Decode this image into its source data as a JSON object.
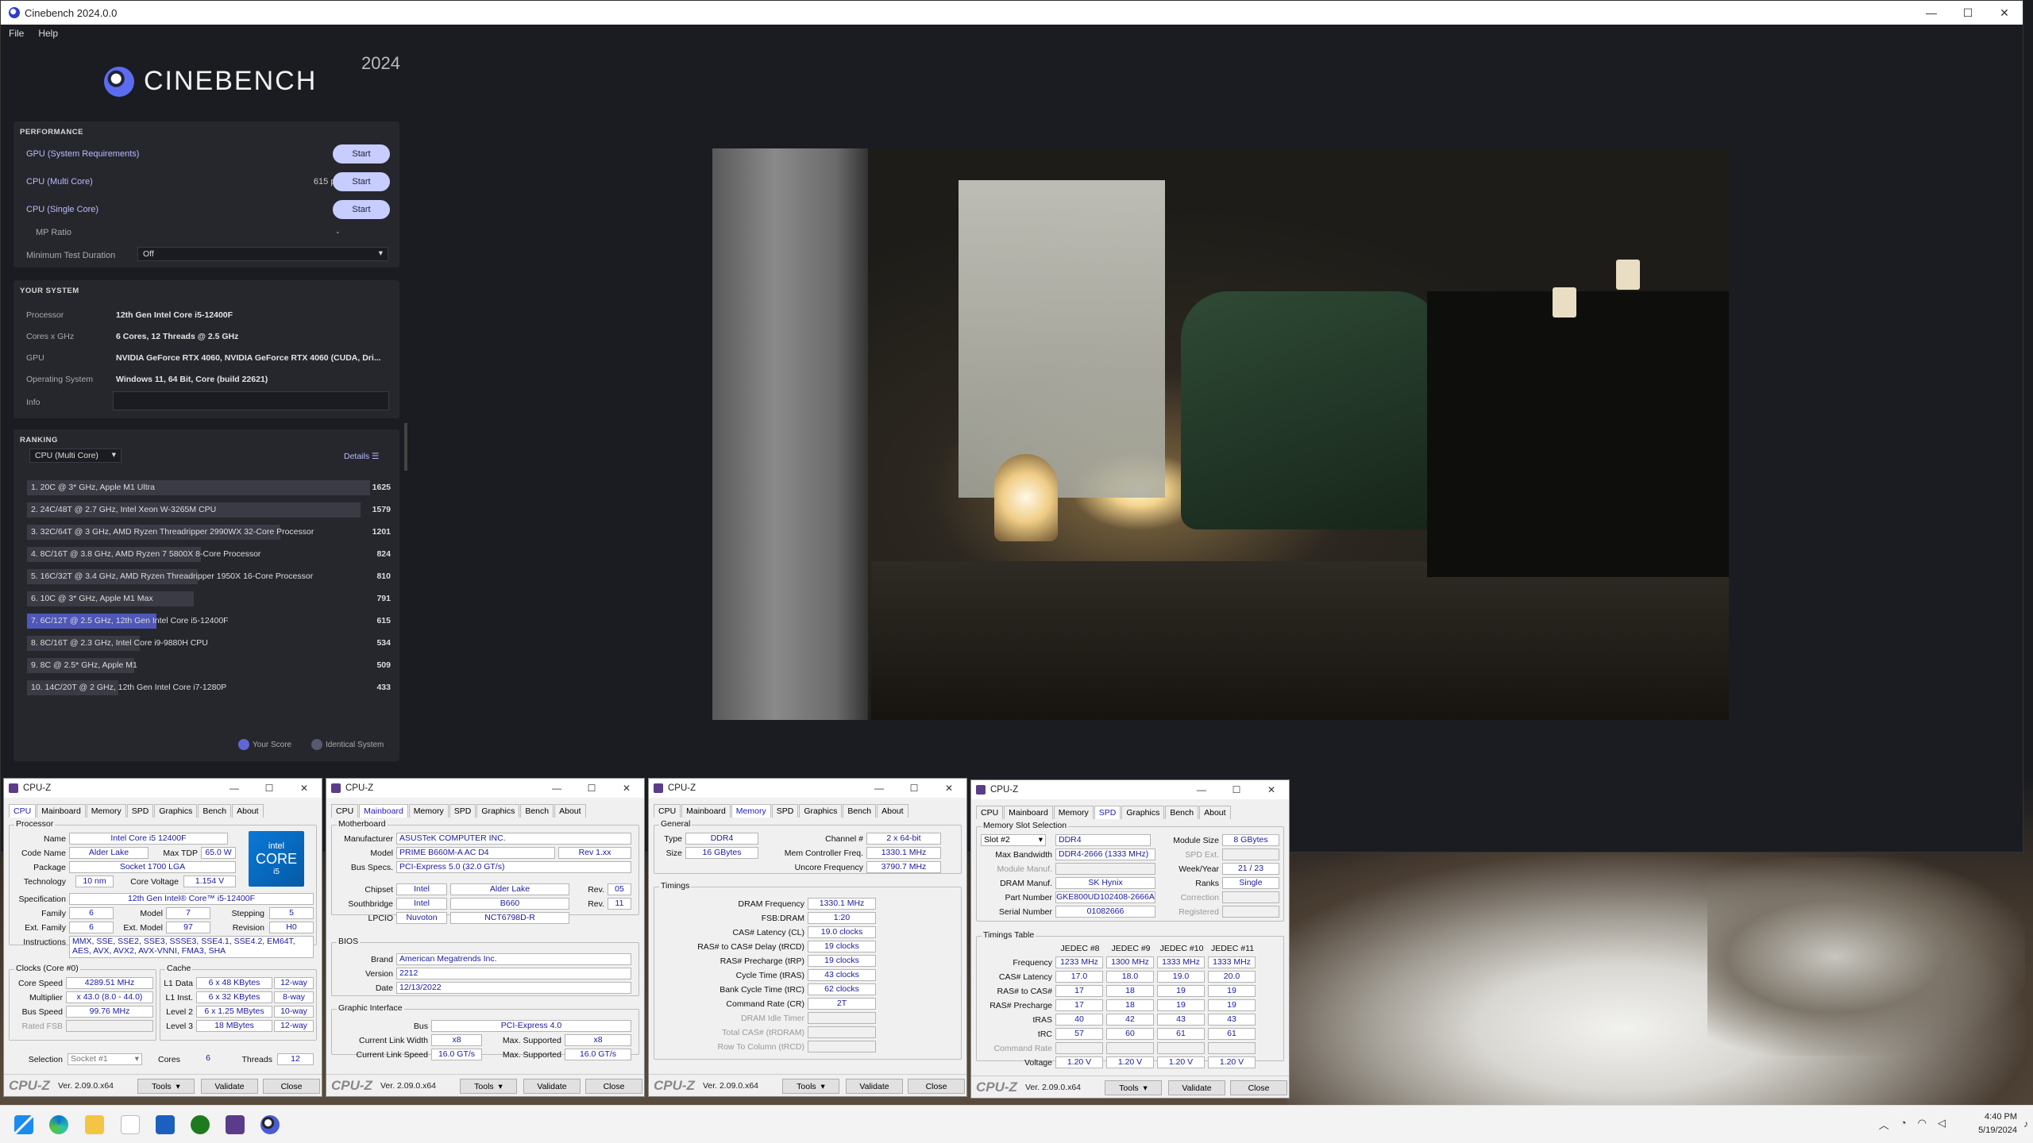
{
  "cinebench": {
    "title": "Cinebench 2024.0.0",
    "menu": [
      "File",
      "Help"
    ],
    "logo": "CINEBENCH",
    "version": "2024",
    "performance": {
      "header": "PERFORMANCE",
      "gpu_label": "GPU (System Requirements)",
      "gpu_value": "-",
      "multi_label": "CPU (Multi Core)",
      "multi_value": "615 pts",
      "single_label": "CPU (Single Core)",
      "single_value": "-",
      "mp_label": "MP Ratio",
      "mp_value": "-",
      "start_label": "Start",
      "min_duration_label": "Minimum Test Duration",
      "min_duration_value": "Off"
    },
    "system": {
      "header": "YOUR SYSTEM",
      "rows": [
        {
          "label": "Processor",
          "value": "12th Gen Intel Core i5-12400F"
        },
        {
          "label": "Cores x GHz",
          "value": "6 Cores, 12 Threads @ 2.5 GHz"
        },
        {
          "label": "GPU",
          "value": "NVIDIA GeForce RTX 4060, NVIDIA GeForce RTX 4060 (CUDA, Dri..."
        },
        {
          "label": "Operating System",
          "value": "Windows 11, 64 Bit, Core (build 22621)"
        },
        {
          "label": "Info",
          "value": ""
        }
      ]
    },
    "ranking": {
      "header": "RANKING",
      "dropdown": "CPU (Multi Core)",
      "details": "Details",
      "max_score": 1625,
      "items": [
        {
          "label": "1. 20C @ 3* GHz, Apple M1 Ultra",
          "score": 1625,
          "me": false
        },
        {
          "label": "2. 24C/48T @ 2.7 GHz, Intel Xeon W-3265M CPU",
          "score": 1579,
          "me": false
        },
        {
          "label": "3. 32C/64T @ 3 GHz, AMD Ryzen Threadripper 2990WX 32-Core Processor",
          "score": 1201,
          "me": false
        },
        {
          "label": "4. 8C/16T @ 3.8 GHz, AMD Ryzen 7 5800X 8-Core Processor",
          "score": 824,
          "me": false
        },
        {
          "label": "5. 16C/32T @ 3.4 GHz, AMD Ryzen Threadripper 1950X 16-Core Processor",
          "score": 810,
          "me": false
        },
        {
          "label": "6. 10C @ 3* GHz, Apple M1 Max",
          "score": 791,
          "me": false
        },
        {
          "label": "7. 6C/12T @ 2.5 GHz, 12th Gen Intel Core i5-12400F",
          "score": 615,
          "me": true
        },
        {
          "label": "8. 8C/16T @ 2.3 GHz, Intel Core i9-9880H CPU",
          "score": 534,
          "me": false
        },
        {
          "label": "9. 8C @ 2.5* GHz, Apple M1",
          "score": 509,
          "me": false
        },
        {
          "label": "10. 14C/20T @ 2 GHz, 12th Gen Intel Core i7-1280P",
          "score": 433,
          "me": false
        }
      ],
      "legend_you": "Your Score",
      "legend_identical": "Identical System"
    }
  },
  "cpuz_common": {
    "title": "CPU-Z",
    "tabs": [
      "CPU",
      "Mainboard",
      "Memory",
      "SPD",
      "Graphics",
      "Bench",
      "About"
    ],
    "brand": "CPU-Z",
    "version": "Ver. 2.09.0.x64",
    "tools": "Tools",
    "validate": "Validate",
    "close": "Close"
  },
  "cpuz_cpu": {
    "processor_title": "Processor",
    "name_label": "Name",
    "name": "Intel Core i5 12400F",
    "codename_label": "Code Name",
    "codename": "Alder Lake",
    "maxtdp_label": "Max TDP",
    "maxtdp": "65.0 W",
    "package_label": "Package",
    "package": "Socket 1700 LGA",
    "tech_label": "Technology",
    "tech": "10 nm",
    "corevolt_label": "Core Voltage",
    "corevolt": "1.154 V",
    "spec_label": "Specification",
    "spec": "12th Gen Intel® Core™ i5-12400F",
    "family_label": "Family",
    "family": "6",
    "model_label": "Model",
    "model": "7",
    "stepping_label": "Stepping",
    "stepping": "5",
    "extfam_label": "Ext. Family",
    "extfam": "6",
    "extmodel_label": "Ext. Model",
    "extmodel": "97",
    "revision_label": "Revision",
    "revision": "H0",
    "instr_label": "Instructions",
    "instr": "MMX, SSE, SSE2, SSE3, SSSE3, SSE4.1, SSE4.2, EM64T, AES, AVX, AVX2, AVX-VNNI, FMA3, SHA",
    "clocks_title": "Clocks (Core #0)",
    "corespeed_label": "Core Speed",
    "corespeed": "4289.51 MHz",
    "multiplier_label": "Multiplier",
    "multiplier": "x 43.0 (8.0 - 44.0)",
    "busspeed_label": "Bus Speed",
    "busspeed": "99.76 MHz",
    "ratedfsb_label": "Rated FSB",
    "cache_title": "Cache",
    "l1d_label": "L1 Data",
    "l1d": "6 x 48 KBytes",
    "l1d_way": "12-way",
    "l1i_label": "L1 Inst.",
    "l1i": "6 x 32 KBytes",
    "l1i_way": "8-way",
    "l2_label": "Level 2",
    "l2": "6 x 1.25 MBytes",
    "l2_way": "10-way",
    "l3_label": "Level 3",
    "l3": "18 MBytes",
    "l3_way": "12-way",
    "selection_label": "Selection",
    "selection": "Socket #1",
    "cores_label": "Cores",
    "cores": "6",
    "threads_label": "Threads",
    "threads": "12",
    "intel_top": "intel",
    "intel_mid": "CORE",
    "intel_bot": "i5"
  },
  "cpuz_mb": {
    "mb_title": "Motherboard",
    "manuf_label": "Manufacturer",
    "manuf": "ASUSTeK COMPUTER INC.",
    "model_label": "Model",
    "model": "PRIME B660M-A AC D4",
    "model_rev": "Rev 1.xx",
    "busspecs_label": "Bus Specs.",
    "busspecs": "PCI-Express 5.0 (32.0 GT/s)",
    "chipset_label": "Chipset",
    "chipset_v": "Intel",
    "chipset_m": "Alder Lake",
    "rev_label": "Rev.",
    "chipset_rev": "05",
    "south_label": "Southbridge",
    "south_v": "Intel",
    "south_m": "B660",
    "south_rev": "11",
    "lpcio_label": "LPCIO",
    "lpcio_v": "Nuvoton",
    "lpcio_m": "NCT6798D-R",
    "bios_title": "BIOS",
    "brand_label": "Brand",
    "brand": "American Megatrends Inc.",
    "version_label": "Version",
    "version": "2212",
    "date_label": "Date",
    "date": "12/13/2022",
    "gi_title": "Graphic Interface",
    "bus_label": "Bus",
    "bus": "PCI-Express 4.0",
    "clw_label": "Current Link Width",
    "clw": "x8",
    "maxsup_label": "Max. Supported",
    "maxw": "x8",
    "cls_label": "Current Link Speed",
    "cls": "16.0 GT/s",
    "maxs": "16.0 GT/s"
  },
  "cpuz_mem": {
    "general_title": "General",
    "type_label": "Type",
    "type": "DDR4",
    "size_label": "Size",
    "size": "16 GBytes",
    "channel_label": "Channel #",
    "channel": "2 x 64-bit",
    "mcf_label": "Mem Controller Freq.",
    "mcf": "1330.1 MHz",
    "uncore_label": "Uncore Frequency",
    "uncore": "3790.7 MHz",
    "timings_title": "Timings",
    "rows": [
      {
        "label": "DRAM Frequency",
        "value": "1330.1 MHz",
        "dim": false
      },
      {
        "label": "FSB:DRAM",
        "value": "1:20",
        "dim": false
      },
      {
        "label": "CAS# Latency (CL)",
        "value": "19.0 clocks",
        "dim": false
      },
      {
        "label": "RAS# to CAS# Delay (tRCD)",
        "value": "19 clocks",
        "dim": false
      },
      {
        "label": "RAS# Precharge (tRP)",
        "value": "19 clocks",
        "dim": false
      },
      {
        "label": "Cycle Time (tRAS)",
        "value": "43 clocks",
        "dim": false
      },
      {
        "label": "Bank Cycle Time (tRC)",
        "value": "62 clocks",
        "dim": false
      },
      {
        "label": "Command Rate (CR)",
        "value": "2T",
        "dim": false
      },
      {
        "label": "DRAM Idle Timer",
        "value": "",
        "dim": true
      },
      {
        "label": "Total CAS# (tRDRAM)",
        "value": "",
        "dim": true
      },
      {
        "label": "Row To Column (tRCD)",
        "value": "",
        "dim": true
      }
    ]
  },
  "cpuz_spd": {
    "slot_title": "Memory Slot Selection",
    "slot": "Slot #2",
    "type": "DDR4",
    "modsize_label": "Module Size",
    "modsize": "8 GBytes",
    "maxbw_label": "Max Bandwidth",
    "maxbw": "DDR4-2666 (1333 MHz)",
    "spdext_label": "SPD Ext.",
    "modmanuf_label": "Module Manuf.",
    "weekyear_label": "Week/Year",
    "weekyear": "21 / 23",
    "drammanuf_label": "DRAM Manuf.",
    "drammanuf": "SK Hynix",
    "ranks_label": "Ranks",
    "ranks": "Single",
    "part_label": "Part Number",
    "part": "GKE800UD102408-2666A",
    "correction_label": "Correction",
    "serial_label": "Serial Number",
    "serial": "01082666",
    "registered_label": "Registered",
    "tt_title": "Timings Table",
    "cols": [
      "JEDEC #8",
      "JEDEC #9",
      "JEDEC #10",
      "JEDEC #11"
    ],
    "rows": [
      {
        "label": "Frequency",
        "vals": [
          "1233 MHz",
          "1300 MHz",
          "1333 MHz",
          "1333 MHz"
        ],
        "dim": false
      },
      {
        "label": "CAS# Latency",
        "vals": [
          "17.0",
          "18.0",
          "19.0",
          "20.0"
        ],
        "dim": false
      },
      {
        "label": "RAS# to CAS#",
        "vals": [
          "17",
          "18",
          "19",
          "19"
        ],
        "dim": false
      },
      {
        "label": "RAS# Precharge",
        "vals": [
          "17",
          "18",
          "19",
          "19"
        ],
        "dim": false
      },
      {
        "label": "tRAS",
        "vals": [
          "40",
          "42",
          "43",
          "43"
        ],
        "dim": false
      },
      {
        "label": "tRC",
        "vals": [
          "57",
          "60",
          "61",
          "61"
        ],
        "dim": false
      },
      {
        "label": "Command Rate",
        "vals": [
          "",
          "",
          "",
          ""
        ],
        "dim": true
      },
      {
        "label": "Voltage",
        "vals": [
          "1.20 V",
          "1.20 V",
          "1.20 V",
          "1.20 V"
        ],
        "dim": false
      }
    ]
  },
  "taskbar": {
    "time": "4:40 PM",
    "date": "5/19/2024"
  },
  "colors": {
    "accent": "#c7cdff",
    "highlight": "#4f57b9",
    "cpuz_value": "#1a1aa0"
  }
}
